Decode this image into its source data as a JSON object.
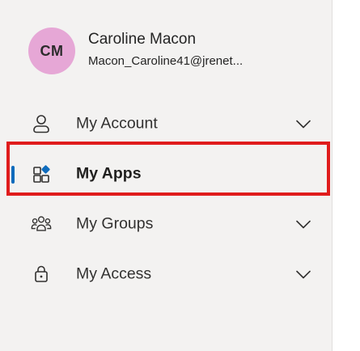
{
  "user": {
    "initials": "CM",
    "name": "Caroline Macon",
    "email": "Macon_Caroline41@jrenet..."
  },
  "nav": {
    "items": [
      {
        "label": "My Account",
        "icon": "person-icon",
        "expandable": true,
        "active": false
      },
      {
        "label": "My Apps",
        "icon": "apps-icon",
        "expandable": false,
        "active": true
      },
      {
        "label": "My Groups",
        "icon": "people-group-icon",
        "expandable": true,
        "active": false
      },
      {
        "label": "My Access",
        "icon": "lock-icon",
        "expandable": true,
        "active": false
      }
    ]
  },
  "colors": {
    "avatar_bg": "#e6a7d6",
    "active_indicator": "#0f6cbd",
    "highlight_border": "#e01c1c",
    "panel_bg": "#f3f2f1"
  }
}
